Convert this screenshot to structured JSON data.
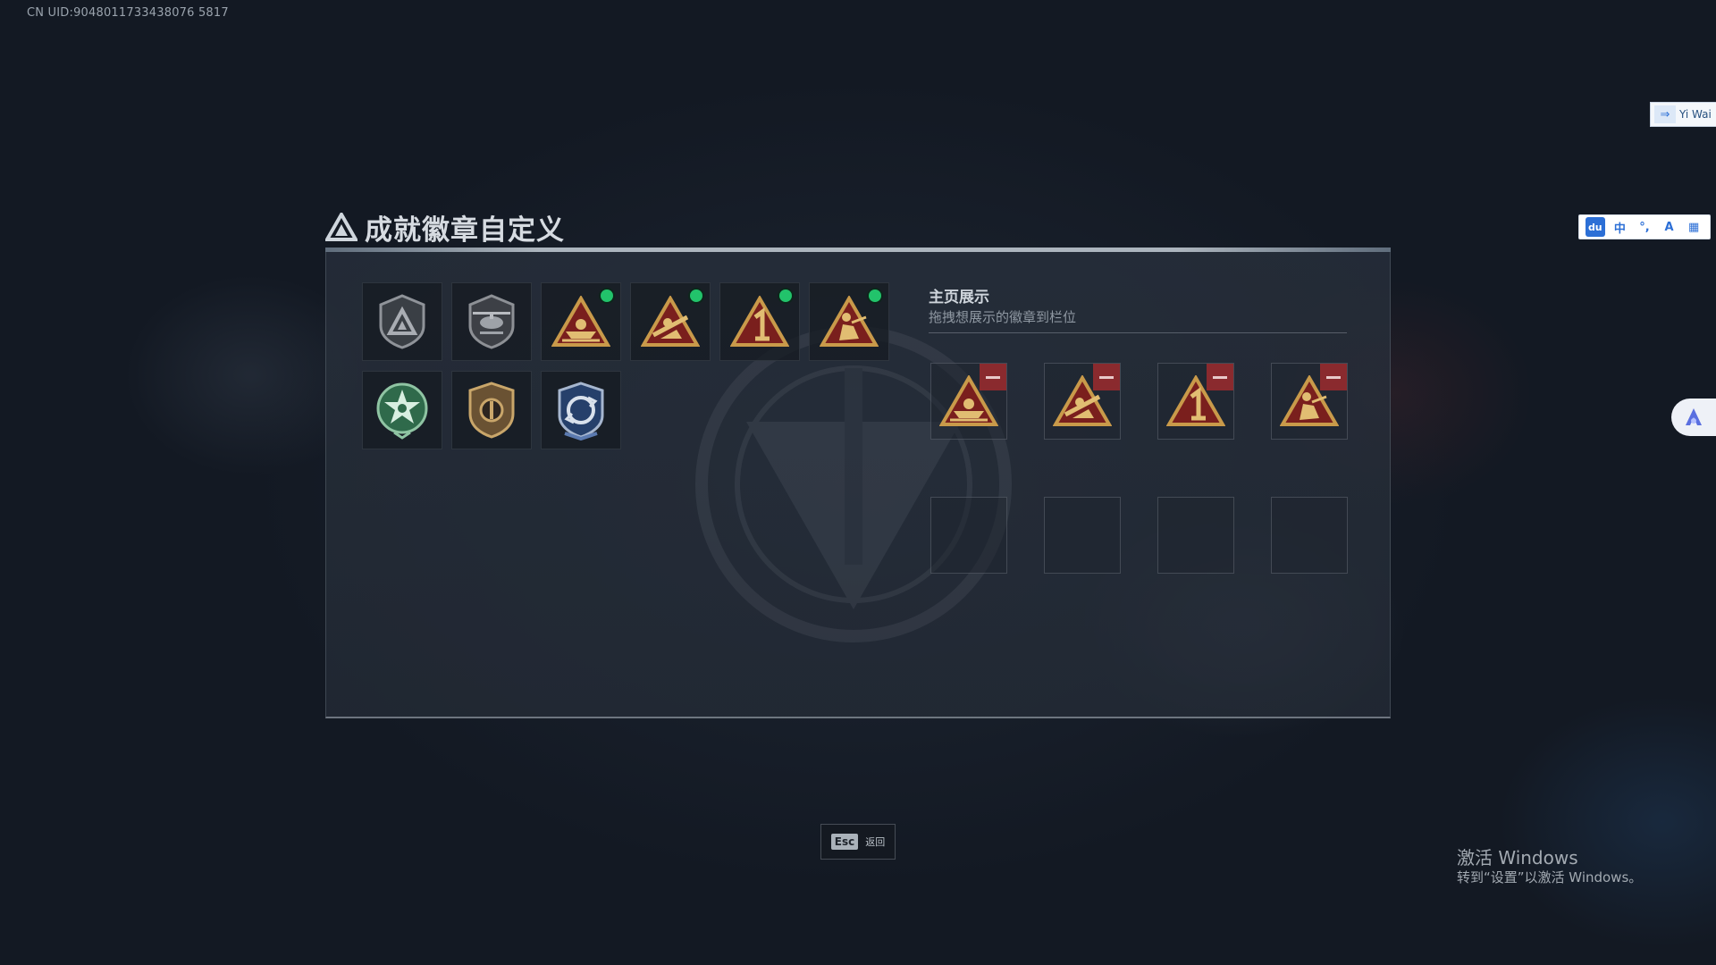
{
  "uid_text": "CN UID:9048011733438076 5817",
  "page": {
    "title": "成就徽章自定义",
    "title_icon": "triangle-logo-icon"
  },
  "inventory": {
    "badges": [
      {
        "name": "rank-shield-badge",
        "equipped": false
      },
      {
        "name": "helicopter-shield-badge",
        "equipped": false
      },
      {
        "name": "boat-triangle-badge",
        "equipped": true
      },
      {
        "name": "gunner-triangle-badge",
        "equipped": true
      },
      {
        "name": "number-one-triangle-badge",
        "equipped": true
      },
      {
        "name": "crouch-soldier-triangle-badge",
        "equipped": true
      },
      {
        "name": "green-star-medal-badge",
        "equipped": false
      },
      {
        "name": "bronze-shield-badge",
        "equipped": false
      },
      {
        "name": "blue-rotation-medal-badge",
        "equipped": false
      }
    ],
    "equipped_indicator_color": "#22c36b"
  },
  "showcase": {
    "title": "主页展示",
    "subtitle": "拖拽想展示的徽章到栏位",
    "slots": [
      {
        "badge": "boat-triangle-badge"
      },
      {
        "badge": "gunner-triangle-badge"
      },
      {
        "badge": "number-one-triangle-badge"
      },
      {
        "badge": "crouch-soldier-triangle-badge"
      },
      {
        "badge": null
      },
      {
        "badge": null
      },
      {
        "badge": null
      },
      {
        "badge": null
      }
    ],
    "remove_color": "#8a2a2e"
  },
  "esc": {
    "key": "Esc",
    "label": "返回"
  },
  "windows_watermark": {
    "line1": "激活 Windows",
    "line2": "转到“设置”以激活 Windows。"
  },
  "ime_toolbar": {
    "du": "du",
    "lang": "中",
    "punct": "°,",
    "skin": "A",
    "grid": "▦"
  },
  "side_tab": {
    "text": "Yi Wai",
    "arrow": "⇒"
  }
}
